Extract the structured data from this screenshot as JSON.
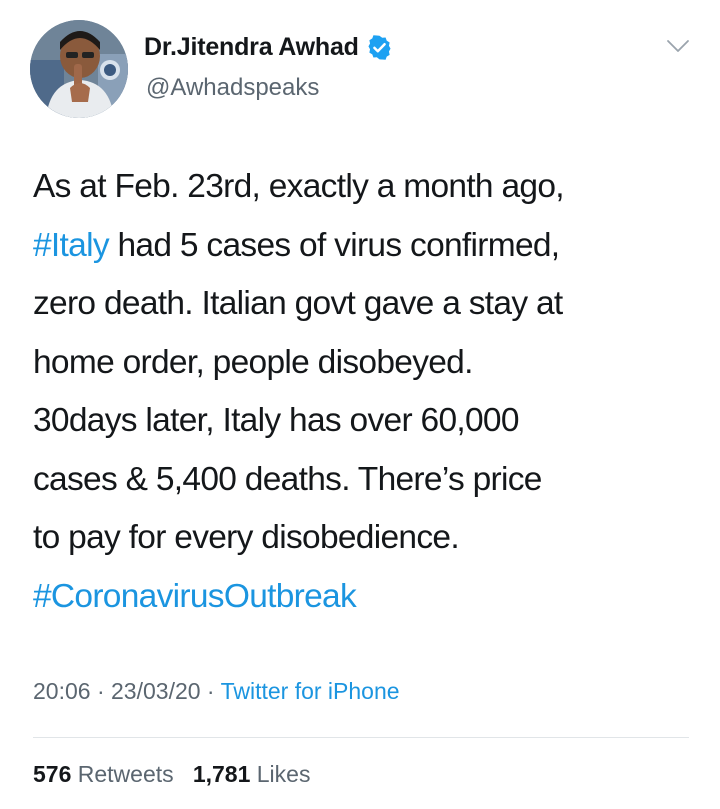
{
  "author": {
    "name": "Dr.Jitendra Awhad",
    "handle": "@Awhadspeaks",
    "verified": true,
    "avatar_icon": "profile-photo",
    "verified_icon": "verified-badge-icon",
    "menu_icon": "chevron-down-icon"
  },
  "tweet": {
    "line1": "As at Feb. 23rd, exactly a month ago,",
    "line2_hashtag": "#Italy",
    "line2_rest": " had 5 cases of virus confirmed,",
    "line3": "zero death. Italian govt gave a stay at",
    "line4": "home order, people disobeyed.",
    "line5": "30days later, Italy has over 60,000",
    "line6": "cases & 5,400 deaths. There’s price",
    "line7": "to pay for every disobedience.",
    "line8_hashtag": "#CoronavirusOutbreak"
  },
  "meta": {
    "time": "20:06",
    "sep1": " · ",
    "date": "23/03/20",
    "sep2": " · ",
    "source": "Twitter for iPhone"
  },
  "stats": {
    "retweets_count": "576",
    "retweets_label": " Retweets",
    "likes_count": "1,781",
    "likes_label": " Likes"
  },
  "colors": {
    "link": "#1b95e0",
    "text": "#14171a",
    "secondary": "#5b6670",
    "divider": "#e1e5e8"
  }
}
